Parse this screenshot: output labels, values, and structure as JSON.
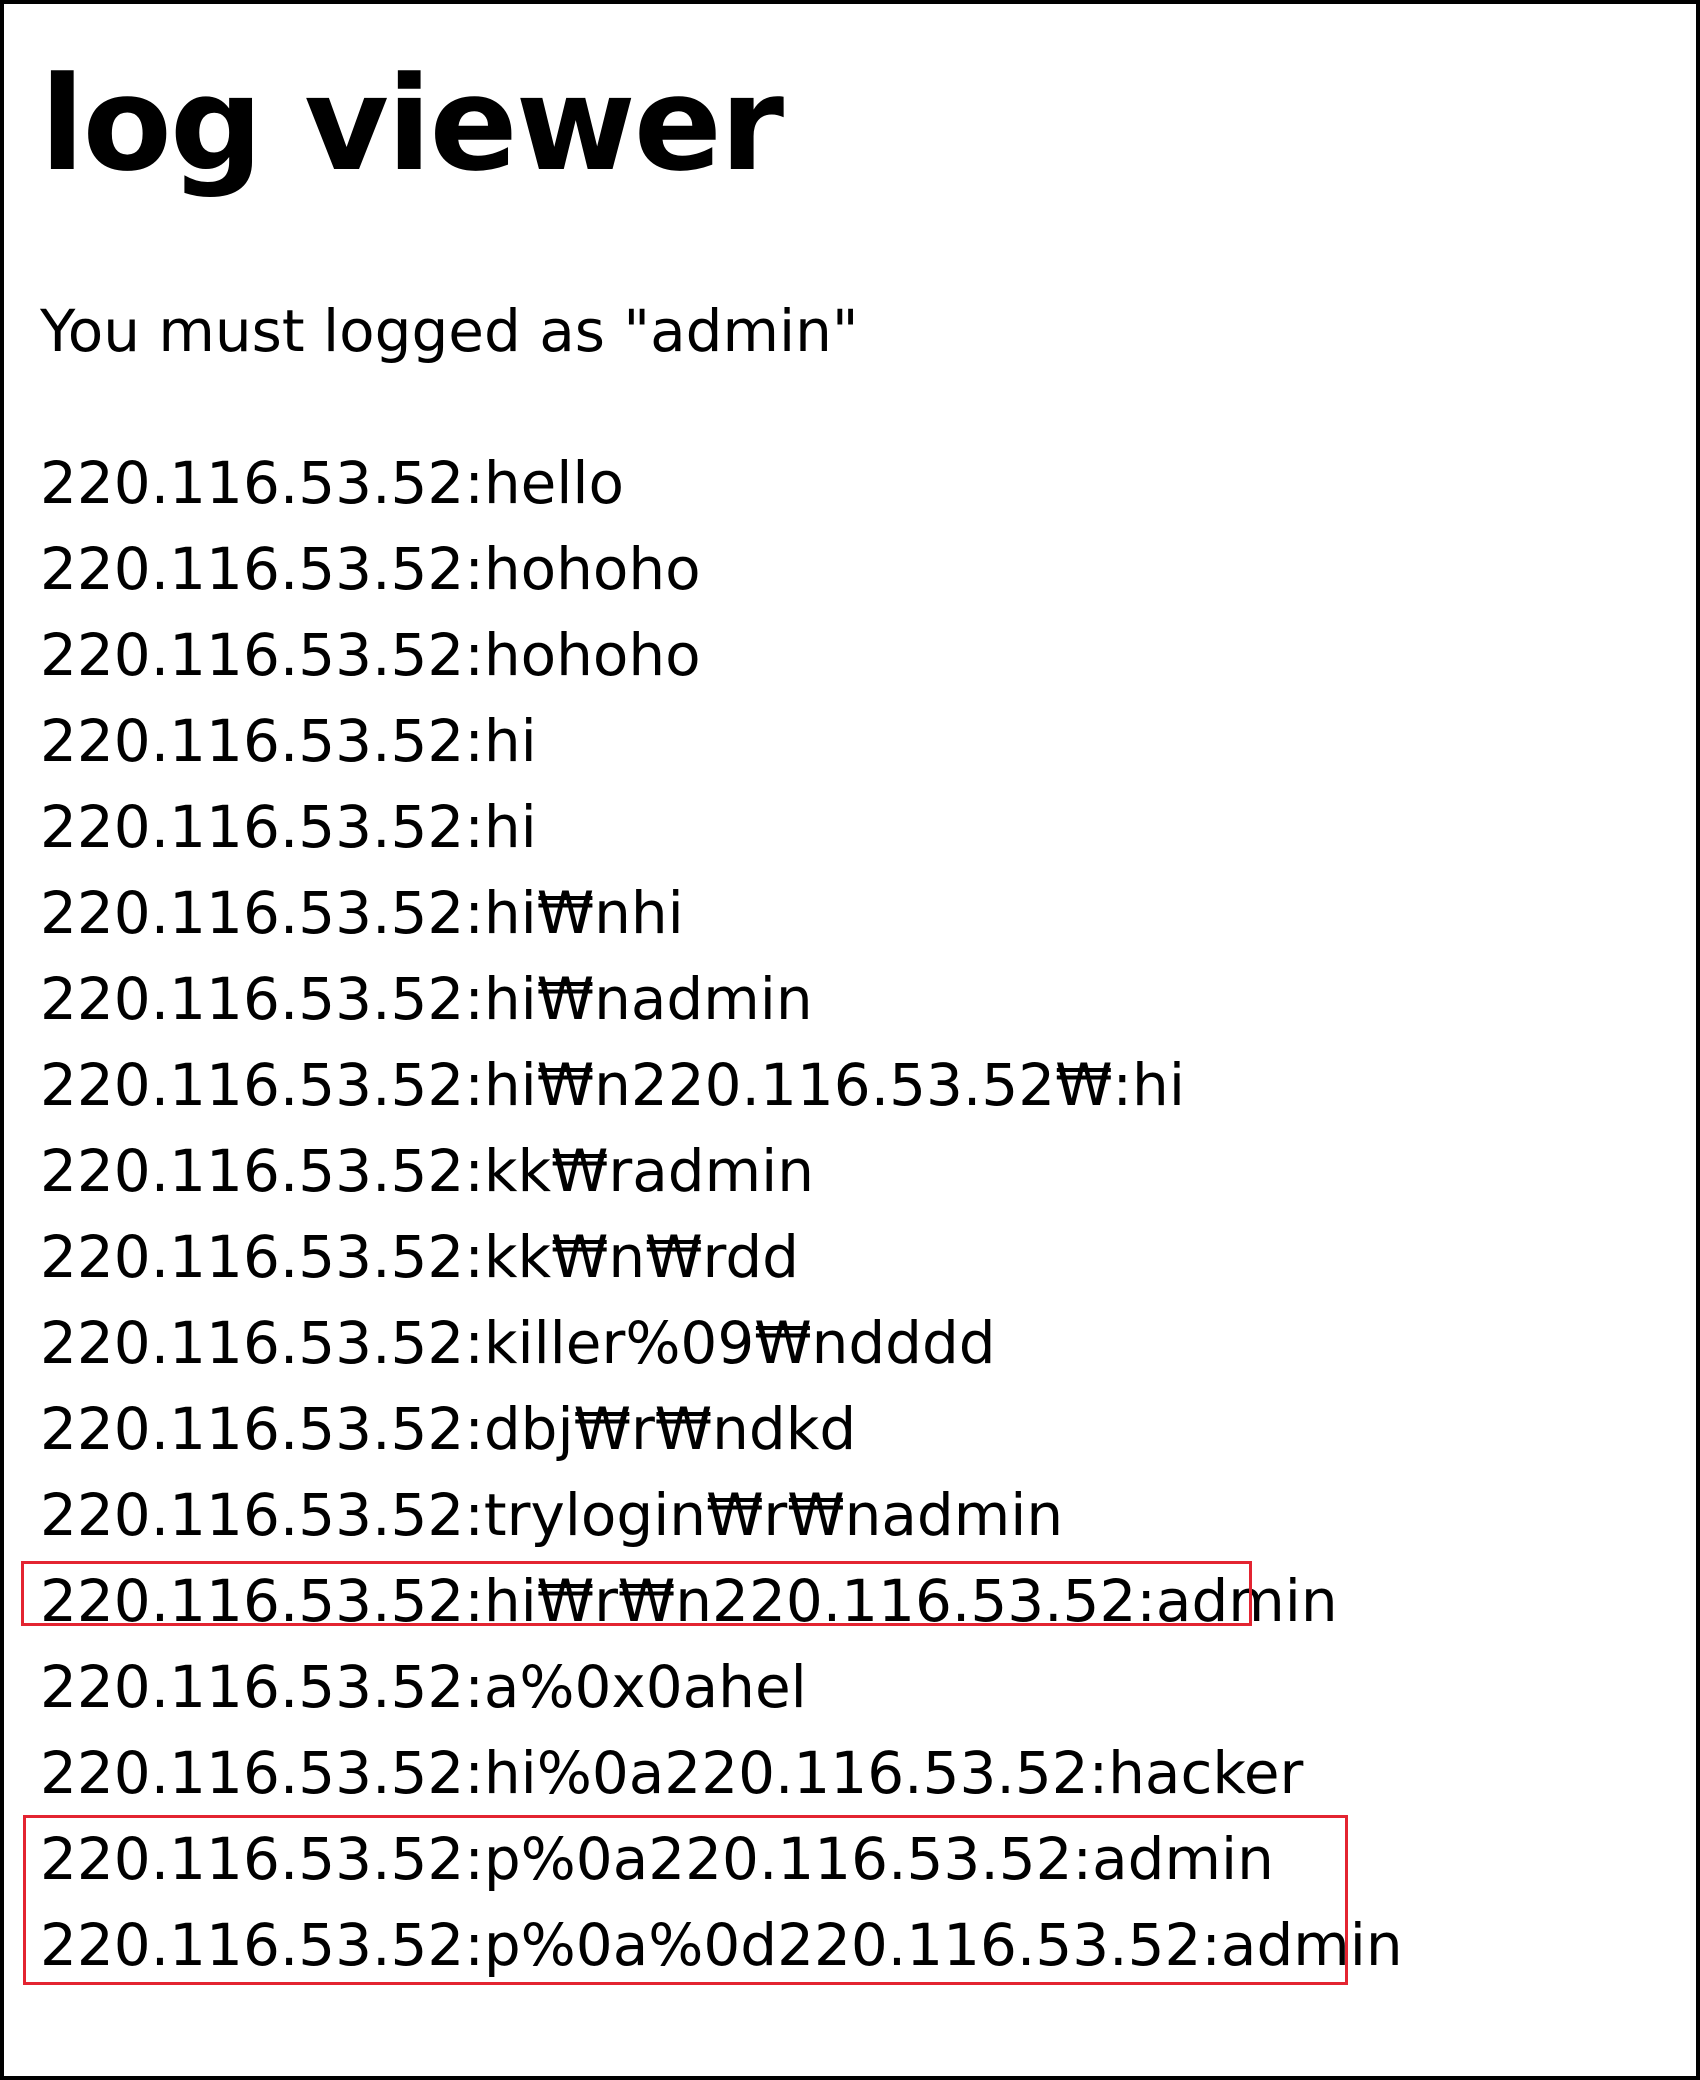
{
  "page": {
    "title": "log viewer",
    "subtitle": "You must logged as \"admin\"",
    "highlight_color": "#e32431"
  },
  "logs": [
    "220.116.53.52:hello",
    "220.116.53.52:hohoho",
    "220.116.53.52:hohoho",
    "220.116.53.52:hi",
    "220.116.53.52:hi",
    "220.116.53.52:hi₩nhi",
    "220.116.53.52:hi₩nadmin",
    "220.116.53.52:hi₩n220.116.53.52₩:hi",
    "220.116.53.52:kk₩radmin",
    "220.116.53.52:kk₩n₩rdd",
    "220.116.53.52:killer%09₩ndddd",
    "220.116.53.52:dbj₩r₩ndkd",
    "220.116.53.52:trylogin₩r₩nadmin",
    "220.116.53.52:hi₩r₩n220.116.53.52:admin",
    "220.116.53.52:a%0x0ahel",
    "220.116.53.52:hi%0a220.116.53.52:hacker",
    "220.116.53.52:p%0a220.116.53.52:admin",
    "220.116.53.52:p%0a%0d220.116.53.52:admin"
  ]
}
